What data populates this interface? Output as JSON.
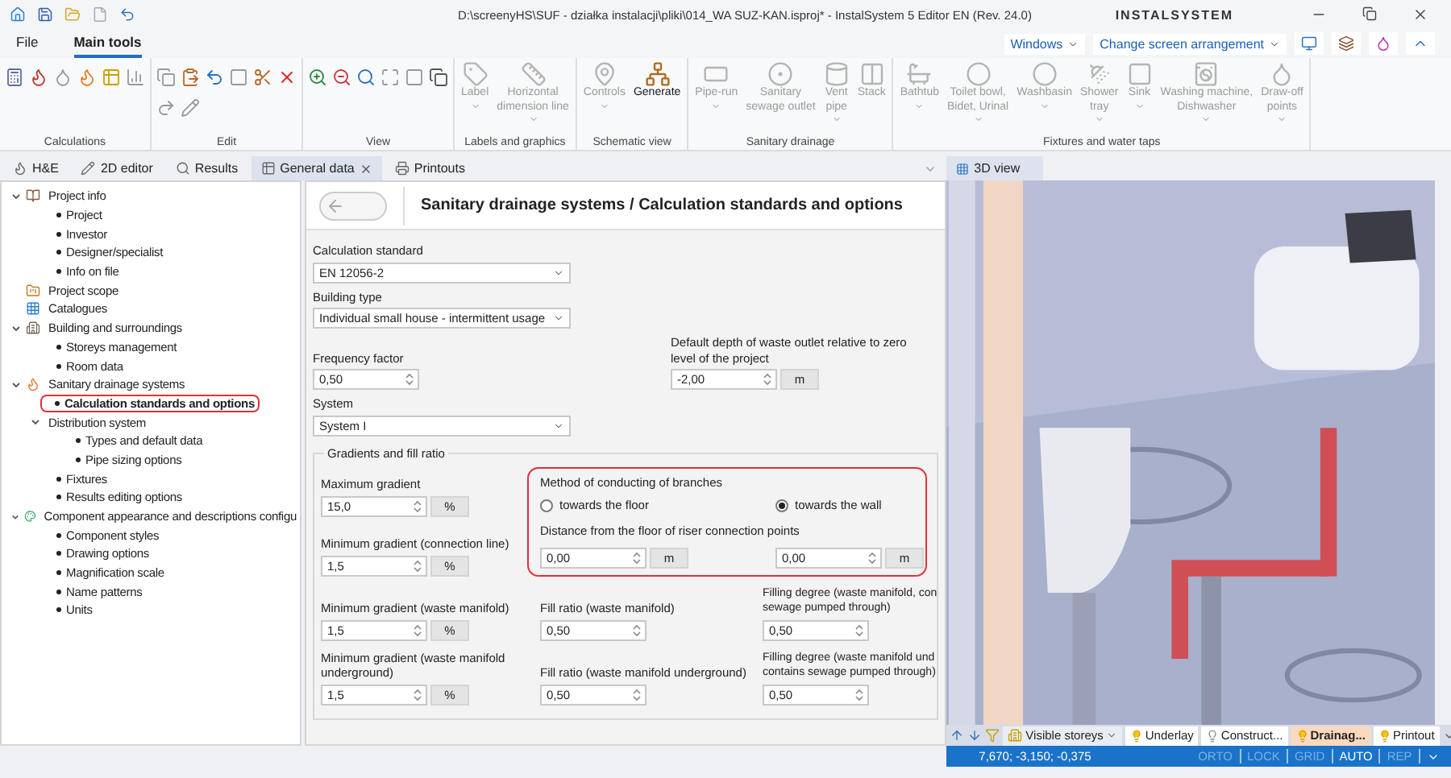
{
  "window": {
    "title": "D:\\screenyHS\\SUF - działka instalacji\\pliki\\014_WA SUZ-KAN.isproj* - InstalSystem 5 Editor EN (Rev. 24.0)",
    "brand": "INSTALSYSTEM"
  },
  "menu_tabs": [
    {
      "label": "File",
      "selected": false
    },
    {
      "label": "Main tools",
      "selected": true
    }
  ],
  "top_controls": {
    "windows": "Windows",
    "arrangement": "Change screen arrangement"
  },
  "ribbon": [
    {
      "name": "Calculations",
      "kind": "calculations"
    },
    {
      "name": "Edit",
      "kind": "edit"
    },
    {
      "name": "View",
      "kind": "view"
    },
    {
      "name": "Labels and graphics",
      "kind": "tools",
      "tools": [
        {
          "label": "Label",
          "disabled": true,
          "dropdown": true
        },
        {
          "label": "Horizontal\ndimension line",
          "disabled": true,
          "dropdown": true
        }
      ]
    },
    {
      "name": "Schematic view",
      "kind": "tools",
      "tools": [
        {
          "label": "Controls",
          "disabled": true,
          "dropdown": true
        },
        {
          "label": "Generate",
          "disabled": false,
          "dropdown": false
        }
      ]
    },
    {
      "name": "Sanitary drainage",
      "kind": "tools",
      "tools": [
        {
          "label": "Pipe-run",
          "disabled": true,
          "dropdown": true
        },
        {
          "label": "Sanitary\nsewage outlet",
          "disabled": true,
          "dropdown": false
        },
        {
          "label": "Vent\npipe",
          "disabled": true,
          "dropdown": true
        },
        {
          "label": "Stack",
          "disabled": true,
          "dropdown": false
        }
      ]
    },
    {
      "name": "Fixtures and water taps",
      "kind": "tools",
      "tools": [
        {
          "label": "Bathtub",
          "disabled": true,
          "dropdown": true
        },
        {
          "label": "Toilet bowl,\nBidet, Urinal",
          "disabled": true,
          "dropdown": true
        },
        {
          "label": "Washbasin",
          "disabled": true,
          "dropdown": true
        },
        {
          "label": "Shower\ntray",
          "disabled": true,
          "dropdown": true
        },
        {
          "label": "Sink",
          "disabled": true,
          "dropdown": true
        },
        {
          "label": "Washing machine,\nDishwasher",
          "disabled": true,
          "dropdown": true
        },
        {
          "label": "Draw-off\npoints",
          "disabled": true,
          "dropdown": true
        }
      ]
    }
  ],
  "doc_tabs": [
    {
      "label": "H&E",
      "selected": false,
      "closable": false
    },
    {
      "label": "2D editor",
      "selected": false,
      "closable": false
    },
    {
      "label": "Results",
      "selected": false,
      "closable": false
    },
    {
      "label": "General data",
      "selected": true,
      "closable": true
    },
    {
      "label": "Printouts",
      "selected": false,
      "closable": false
    }
  ],
  "tree": [
    {
      "label": "Project info",
      "kind": "folder",
      "expanded": true,
      "children": [
        {
          "label": "Project",
          "kind": "item",
          "selected": false
        },
        {
          "label": "Investor",
          "kind": "item",
          "selected": false
        },
        {
          "label": "Designer/specialist",
          "kind": "item",
          "selected": false
        },
        {
          "label": "Info on file",
          "kind": "item",
          "selected": false
        }
      ]
    },
    {
      "label": "Project scope",
      "kind": "folder"
    },
    {
      "label": "Catalogues",
      "kind": "folder"
    },
    {
      "label": "Building and surroundings",
      "kind": "folder",
      "expanded": true,
      "children": [
        {
          "label": "Storeys management",
          "kind": "item",
          "selected": false
        },
        {
          "label": "Room data",
          "kind": "item",
          "selected": false
        }
      ]
    },
    {
      "label": "Sanitary drainage systems",
      "kind": "folder",
      "expanded": true,
      "children": [
        {
          "label": "Calculation standards and options",
          "kind": "item",
          "selected": true
        },
        {
          "label": "Distribution system",
          "kind": "group",
          "expanded": true,
          "children": [
            {
              "label": "Types and default data",
              "kind": "item",
              "selected": false
            },
            {
              "label": "Pipe sizing options",
              "kind": "item",
              "selected": false
            }
          ]
        },
        {
          "label": "Fixtures",
          "kind": "item",
          "selected": false
        },
        {
          "label": "Results editing options",
          "kind": "item",
          "selected": false
        }
      ]
    },
    {
      "label": "Component appearance and descriptions configu",
      "kind": "folder",
      "expanded": true,
      "children": [
        {
          "label": "Component styles",
          "kind": "item",
          "selected": false
        },
        {
          "label": "Drawing options",
          "kind": "item",
          "selected": false
        },
        {
          "label": "Magnification scale",
          "kind": "item",
          "selected": false
        },
        {
          "label": "Name patterns",
          "kind": "item",
          "selected": false
        },
        {
          "label": "Units",
          "kind": "item",
          "selected": false
        }
      ]
    }
  ],
  "form": {
    "title": "Sanitary drainage systems / Calculation standards and options",
    "calculation_standard": {
      "label": "Calculation standard",
      "value": "EN 12056-2"
    },
    "building_type": {
      "label": "Building type",
      "value": "Individual small house - intermittent usage"
    },
    "frequency_factor": {
      "label": "Frequency factor",
      "value": "0,50"
    },
    "default_depth": {
      "label": "Default depth of waste outlet relative to zero\nlevel of the project",
      "value": "-2,00",
      "unit": "m"
    },
    "system": {
      "label": "System",
      "value": "System I"
    },
    "gradients": {
      "legend": "Gradients and fill ratio",
      "maximum_gradient": {
        "label": "Maximum gradient",
        "value": "15,0",
        "unit": "%"
      },
      "minimum_gradient_connection": {
        "label": "Minimum gradient (connection line)",
        "value": "1,5",
        "unit": "%"
      },
      "branches": {
        "label": "Method of conducting of branches",
        "options": [
          {
            "label": "towards the floor",
            "selected": false
          },
          {
            "label": "towards the wall",
            "selected": true
          }
        ],
        "distance_label": "Distance from the floor of riser connection points",
        "distances": [
          {
            "value": "0,00",
            "unit": "m"
          },
          {
            "value": "0,00",
            "unit": "m"
          }
        ]
      },
      "rows": [
        [
          {
            "label": "Minimum gradient (waste manifold)",
            "value": "1,5",
            "unit": "%"
          },
          {
            "label": "Fill ratio (waste manifold)",
            "value": "0,50"
          },
          {
            "label": "Filling degree (waste manifold, con\nsewage pumped through)",
            "value": "0,50"
          }
        ],
        [
          {
            "label": "Minimum gradient (waste manifold\nunderground)",
            "value": "1,5",
            "unit": "%"
          },
          {
            "label": "Fill ratio (waste manifold underground)",
            "value": "0,50"
          },
          {
            "label": "Filling degree (waste manifold und\ncontains sewage pumped through)",
            "value": "0,50"
          }
        ]
      ]
    }
  },
  "view3d": {
    "tab": "3D view",
    "storeys": "Visible storeys",
    "layers": [
      {
        "label": "Underlay",
        "visible": true,
        "selected": false
      },
      {
        "label": "Construct...",
        "visible": false,
        "selected": false
      },
      {
        "label": "Drainag...",
        "visible": true,
        "selected": true
      },
      {
        "label": "Printout",
        "visible": true,
        "selected": false
      }
    ],
    "coordinates": "7,670; -3,150; -0,375",
    "flags": [
      {
        "label": "ORTO",
        "on": false
      },
      {
        "label": "LOCK",
        "on": false
      },
      {
        "label": "GRID",
        "on": false
      },
      {
        "label": "AUTO",
        "on": true
      },
      {
        "label": "REP",
        "on": false
      }
    ]
  }
}
